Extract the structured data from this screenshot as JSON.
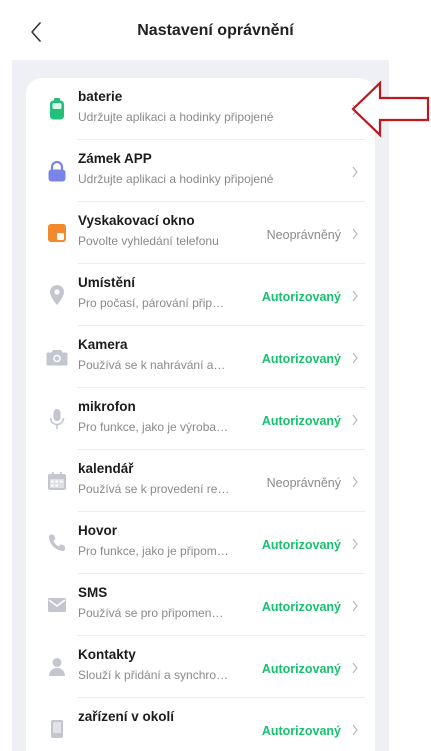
{
  "header": {
    "title": "Nastavení oprávnění"
  },
  "colors": {
    "accent": "#18c16e",
    "page_bg": "#eff0f6",
    "arrow": "#c0161f"
  },
  "rows": [
    {
      "icon": "battery-icon",
      "name": "baterie",
      "desc": "Udržujte aplikaci a hodinky připojené",
      "status": "",
      "status_kind": ""
    },
    {
      "icon": "lock-icon",
      "name": "Zámek APP",
      "desc": "Udržujte aplikaci a hodinky připojené",
      "status": "",
      "status_kind": ""
    },
    {
      "icon": "popup-window-icon",
      "name": "Vyskakovací okno",
      "desc": "Povolte vyhledání telefonu",
      "status": "Neoprávněný",
      "status_kind": "no"
    },
    {
      "icon": "location-icon",
      "name": "Umístění",
      "desc": "Pro počasí, párování připojení hodinek",
      "status": "Autorizovaný",
      "status_kind": "ok"
    },
    {
      "icon": "camera-icon",
      "name": "Kamera",
      "desc": "Používá se k nahrávání avatara",
      "status": "Autorizovaný",
      "status_kind": "ok"
    },
    {
      "icon": "microphone-icon",
      "name": "mikrofon",
      "desc": "Pro funkce, jako je výroba videa",
      "status": "Autorizovaný",
      "status_kind": "ok"
    },
    {
      "icon": "calendar-icon",
      "name": "kalendář",
      "desc": "Používá se k provedení rezervace",
      "status": "Neoprávněný",
      "status_kind": "no"
    },
    {
      "icon": "phone-icon",
      "name": "Hovor",
      "desc": "Pro funkce, jako je připomenutí hovoru",
      "status": "Autorizovaný",
      "status_kind": "ok"
    },
    {
      "icon": "sms-icon",
      "name": "SMS",
      "desc": "Používá se pro připomenutí zpráv",
      "status": "Autorizovaný",
      "status_kind": "ok"
    },
    {
      "icon": "contacts-icon",
      "name": "Kontakty",
      "desc": "Slouží k přidání a synchronizaci kontaktů",
      "status": "Autorizovaný",
      "status_kind": "ok"
    },
    {
      "icon": "nearby-devices-icon",
      "name": "zařízení v okolí",
      "desc": "",
      "status": "Autorizovaný",
      "status_kind": "ok"
    }
  ]
}
